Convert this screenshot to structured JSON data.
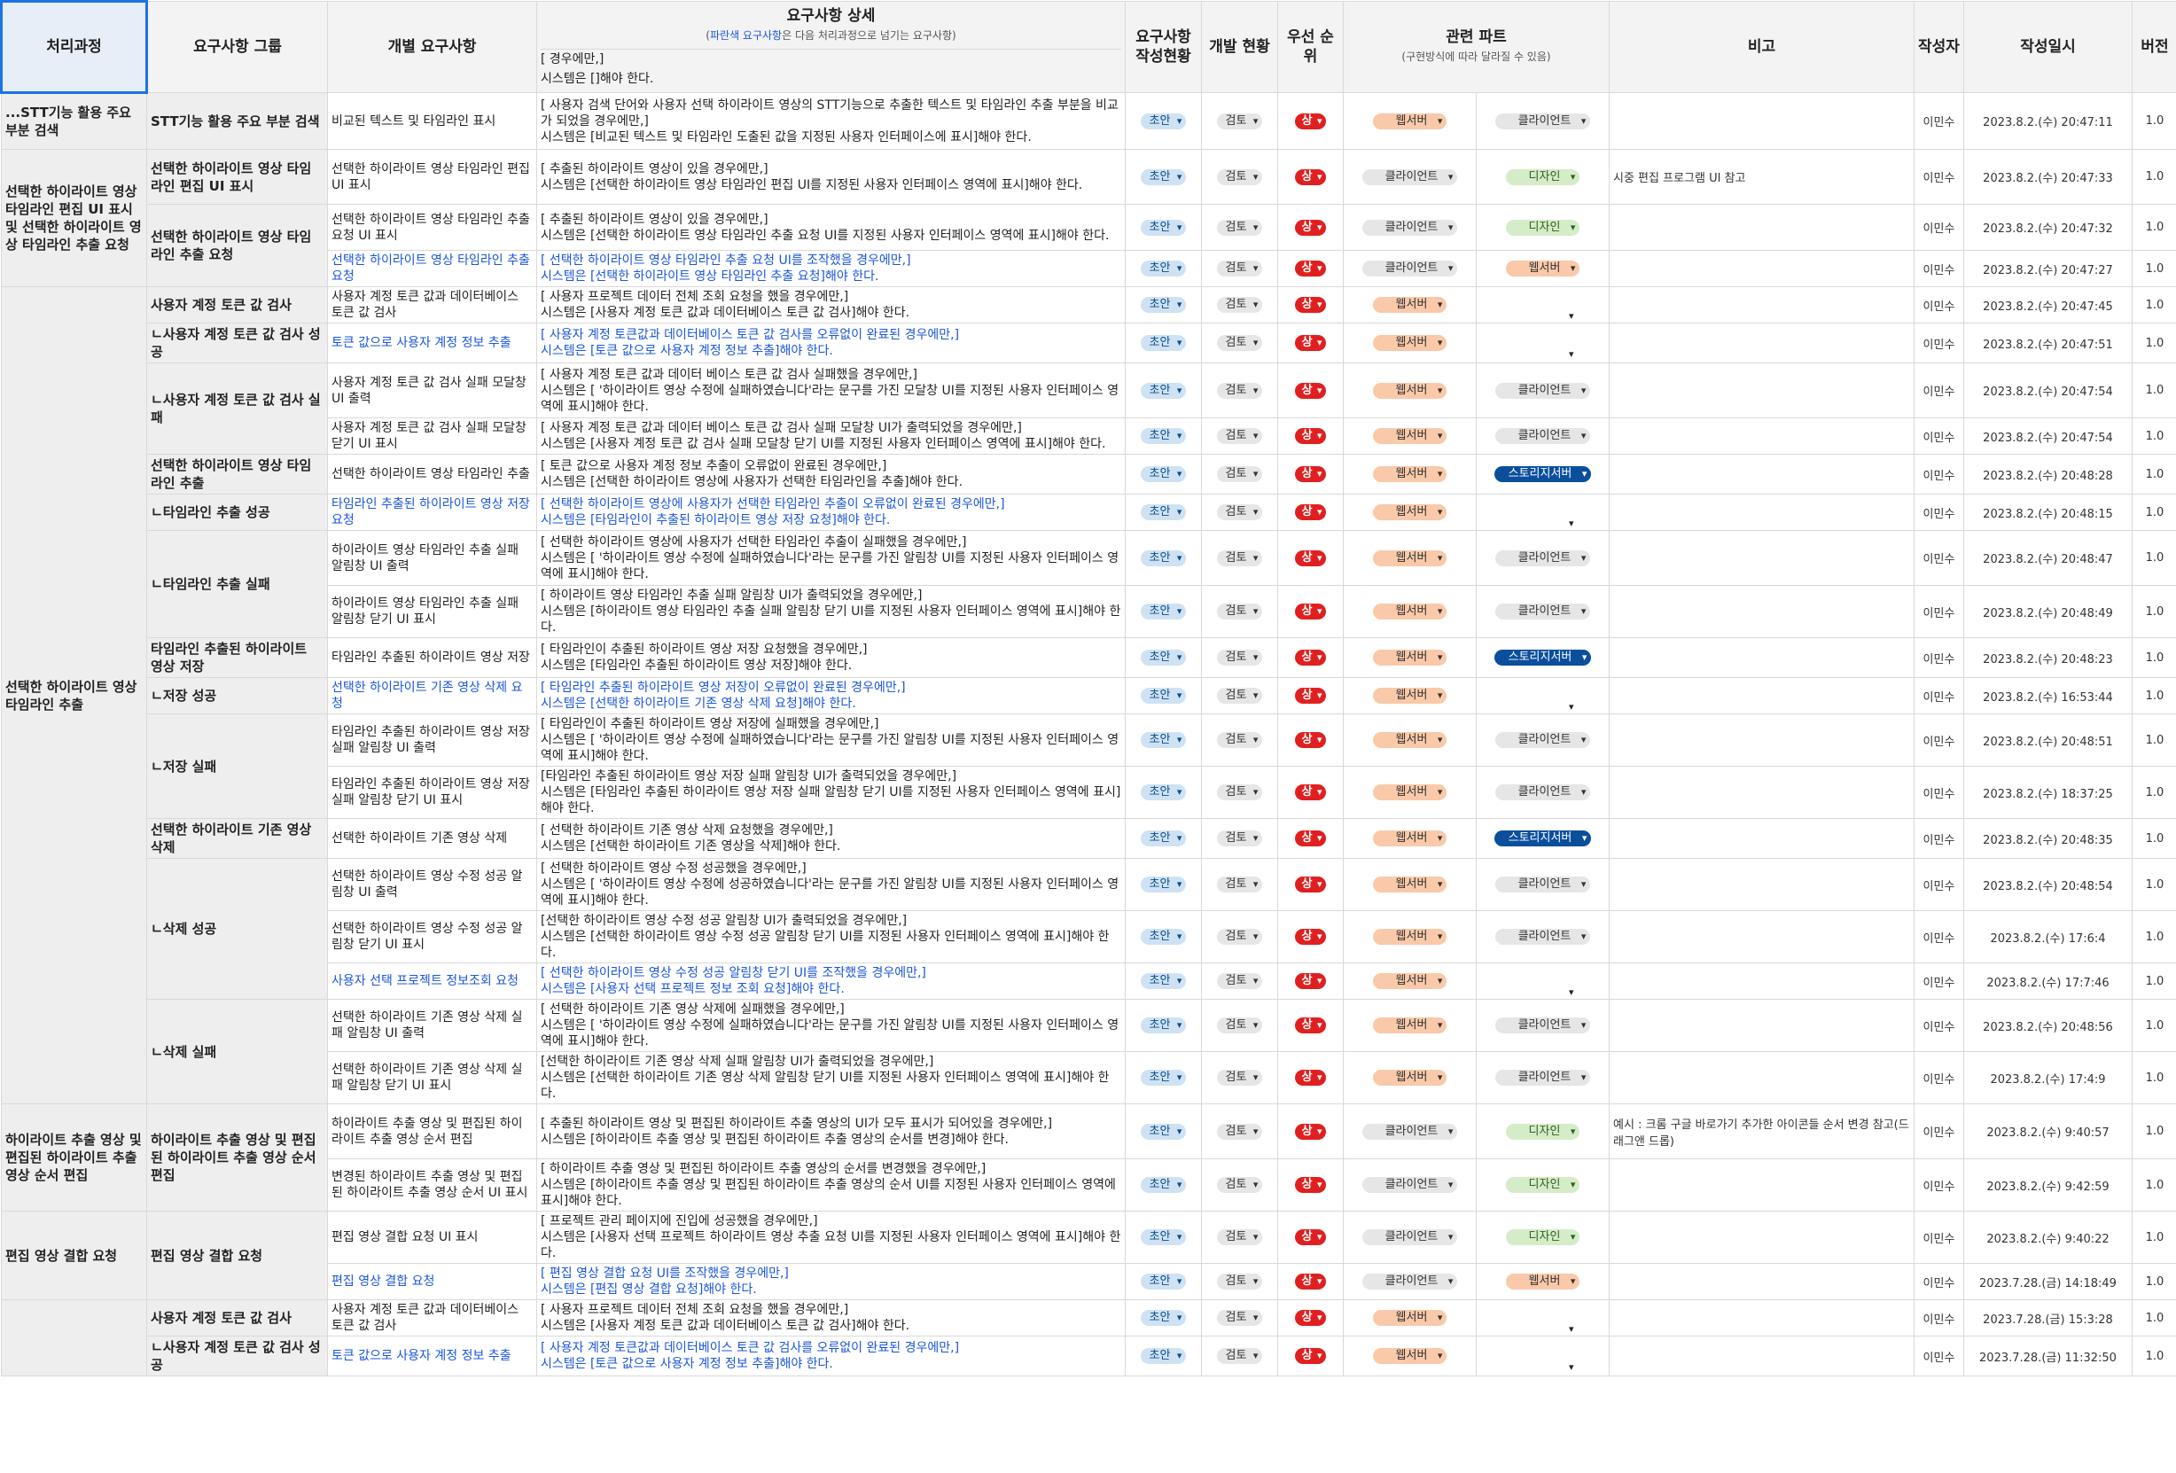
{
  "headers": {
    "process": "처리과정",
    "group": "요구사항 그룹",
    "individual": "개별 요구사항",
    "detail": "요구사항 상세",
    "detail_sub_blue": "파란색 요구사항",
    "detail_sub_rest": "은 다음 처리과정으로 넘기는 요구사항",
    "status": "요구사항 작성현황",
    "dev": "개발 현황",
    "priority": "우선 순위",
    "parts": "관련 파트",
    "parts_sub": "(구현방식에 따라 달라질 수 있음)",
    "note": "비고",
    "author": "작성자",
    "date": "작성일시",
    "version": "버전"
  },
  "labels": {
    "draft": "초안",
    "review": "검토",
    "high": "상"
  },
  "rows": [
    {
      "p": "...STT기능 활용 주요 부분 검색",
      "g": "STT기능 활용 주요 부분 검색",
      "i": "비교된 텍스트 및 타임라인 표시",
      "d": "[ 사용자 검색 단어와 사용자 선택 하이라이트 영상의 STT기능으로 추출한 텍스트 및 타임라인 추출 부분을 비교가 되었을 경우에만,]\n시스템은 [비교된 텍스트 및 타임라인 도출된 값을 지정된 사용자 인터페이스에 표시]해야 한다.",
      "blue": false,
      "p1": "웹서버",
      "p2": "클라이언트",
      "note": "",
      "date": "2023.8.2.(수) 20:47:11"
    },
    {
      "p": "선택한 하이라이트 영상 타임라인 편집 UI 표시 및 선택한 하이라이트 영상 타임라인 추출 요청",
      "g": "선택한 하이라이트 영상 타임라인 편집 UI 표시",
      "i": "선택한 하이라이트 영상 타임라인 편집 UI 표시",
      "d": "[ 추출된 하이라이트 영상이 있을 경우에만,]\n시스템은 [선택한 하이라이트 영상 타임라인 편집 UI를 지정된 사용자 인터페이스 영역에 표시]해야 한다.",
      "blue": false,
      "p1": "클라이언트",
      "p2": "디자인",
      "note": "시중 편집 프로그램 UI 참고",
      "date": "2023.8.2.(수) 20:47:33"
    },
    {
      "p": "",
      "g": "선택한 하이라이트 영상 타임라인 추출 요청",
      "i": "선택한 하이라이트 영상 타임라인 추출 요청 UI 표시",
      "d": "[ 추출된 하이라이트 영상이 있을 경우에만,]\n시스템은 [선택한 하이라이트 영상 타임라인 추출 요청 UI를 지정된 사용자 인터페이스 영역에 표시]해야 한다.",
      "blue": false,
      "p1": "클라이언트",
      "p2": "디자인",
      "note": "",
      "date": "2023.8.2.(수) 20:47:32"
    },
    {
      "p": "",
      "g": "",
      "i": "선택한 하이라이트 영상 타임라인 추출 요청",
      "d": "[ 선택한 하이라이트 영상 타임라인 추출 요청 UI를 조작했을 경우에만,]\n시스템은 [선택한 하이라이트 영상 타임라인 추출 요청]해야 한다.",
      "blue": true,
      "p1": "클라이언트",
      "p2": "웹서버",
      "note": "",
      "date": "2023.8.2.(수) 20:47:27"
    },
    {
      "p": "선택한 하이라이트 영상 타임라인 추출",
      "g": "사용자 계정 토큰 값 검사",
      "i": "사용자 계정 토큰 값과 데이터베이스 토큰 값 검사",
      "d": "[ 사용자 프로젝트 데이터 전체 조회 요청을 했을 경우에만,]\n시스템은 [사용자 계정 토큰 값과 데이터베이스 토큰 값 검사]해야 한다.",
      "blue": false,
      "p1": "웹서버",
      "p2": "",
      "note": "",
      "date": "2023.8.2.(수) 20:47:45"
    },
    {
      "p": "",
      "g": "ㄴ사용자 계정 토큰 값 검사 성공",
      "i": "토큰 값으로 사용자 계정 정보 추출",
      "d": "[ 사용자 계정 토큰값과 데이터베이스 토큰 값 검사를 오류없이 완료된 경우에만,]\n시스템은 [토큰 값으로 사용자 계정 정보 추출]해야 한다.",
      "blue": true,
      "p1": "웹서버",
      "p2": "",
      "note": "",
      "date": "2023.8.2.(수) 20:47:51"
    },
    {
      "p": "",
      "g": "ㄴ사용자 계정 토큰 값 검사 실패",
      "i": "사용자 계정 토큰 값 검사 실패 모달창 UI 출력",
      "d": "[ 사용자 계정 토큰 값과 데이터 베이스 토큰 값 검사 실패했을 경우에만,]\n시스템은 [ '하이라이트 영상 수정에 실패하였습니다'라는 문구를 가진 모달창 UI를 지정된 사용자 인터페이스 영역에 표시]해야 한다.",
      "blue": false,
      "p1": "웹서버",
      "p2": "클라이언트",
      "note": "",
      "date": "2023.8.2.(수) 20:47:54"
    },
    {
      "p": "",
      "g": "",
      "i": "사용자 계정 토큰 값 검사 실패 모달창 닫기 UI 표시",
      "d": "[ 사용자 계정 토큰 값과 데이터 베이스 토큰 값 검사 실패 모달창 UI가 출력되었을 경우에만,]\n시스템은 [사용자 계정 토큰 값 검사 실패 모달창 닫기 UI를 지정된 사용자 인터페이스 영역에 표시]해야 한다.",
      "blue": false,
      "p1": "웹서버",
      "p2": "클라이언트",
      "note": "",
      "date": "2023.8.2.(수) 20:47:54"
    },
    {
      "p": "",
      "g": "선택한 하이라이트 영상 타임라인 추출",
      "i": "선택한 하이라이트 영상 타임라인 추출",
      "d": "[ 토큰 값으로 사용자 계정 정보 추출이 오류없이 완료된 경우에만,]\n시스템은 [선택한 하이라이트 영상에 사용자가 선택한 타임라인을 추출]해야 한다.",
      "blue": false,
      "p1": "웹서버",
      "p2": "스토리지서버",
      "note": "",
      "date": "2023.8.2.(수) 20:48:28"
    },
    {
      "p": "",
      "g": "ㄴ타임라인 추출 성공",
      "i": "타임라인 추출된 하이라이트 영상 저장 요청",
      "d": "[ 선택한 하이라이트 영상에 사용자가 선택한 타임라인 추출이 오류없이 완료된 경우에만,]\n시스템은 [타임라인이 추출된 하이라이트 영상 저장 요청]해야 한다.",
      "blue": true,
      "p1": "웹서버",
      "p2": "",
      "note": "",
      "date": "2023.8.2.(수) 20:48:15"
    },
    {
      "p": "",
      "g": "ㄴ타임라인 추출 실패",
      "i": "하이라이트 영상 타임라인 추출 실패 알림창 UI 출력",
      "d": "[ 선택한 하이라이트 영상에 사용자가 선택한 타임라인 추출이 실패했을 경우에만,]\n시스템은 [ '하이라이트 영상 수정에 실패하였습니다'라는 문구를 가진 알림창 UI를 지정된 사용자 인터페이스 영역에 표시]해야 한다.",
      "blue": false,
      "p1": "웹서버",
      "p2": "클라이언트",
      "note": "",
      "date": "2023.8.2.(수) 20:48:47"
    },
    {
      "p": "",
      "g": "",
      "i": "하이라이트 영상 타임라인 추출 실패 알림창 닫기 UI 표시",
      "d": "[ 하이라이트 영상 타임라인 추출 실패 알림창 UI가 출력되었을 경우에만,]\n시스템은 [하이라이트 영상 타임라인 추출 실패 알림창 닫기 UI를 지정된 사용자 인터페이스 영역에 표시]해야 한다.",
      "blue": false,
      "p1": "웹서버",
      "p2": "클라이언트",
      "note": "",
      "date": "2023.8.2.(수) 20:48:49"
    },
    {
      "p": "",
      "g": "타임라인 추출된 하이라이트 영상 저장",
      "i": "타임라인 추출된 하이라이트 영상 저장",
      "d": "[ 타임라인이 추출된 하이라이트 영상 저장 요청했을 경우에만,]\n시스템은 [타임라인 추출된 하이라이트 영상 저장]해야 한다.",
      "blue": false,
      "p1": "웹서버",
      "p2": "스토리지서버",
      "note": "",
      "date": "2023.8.2.(수) 20:48:23"
    },
    {
      "p": "",
      "g": "ㄴ저장 성공",
      "i": "선택한 하이라이트 기존 영상 삭제 요청",
      "d": "[ 타임라인 추출된 하이라이트 영상 저장이 오류없이 완료된 경우에만,]\n시스템은 [선택한 하이라이트 기존 영상 삭제 요청]해야 한다.",
      "blue": true,
      "p1": "웹서버",
      "p2": "",
      "note": "",
      "date": "2023.8.2.(수) 16:53:44"
    },
    {
      "p": "",
      "g": "ㄴ저장 실패",
      "i": "타임라인 추출된 하이라이트 영상 저장 실패 알림창 UI 출력",
      "d": "[ 타임라인이 추출된 하이라이트 영상 저장에 실패했을 경우에만,]\n시스템은 [ '하이라이트 영상 수정에 실패하였습니다'라는 문구를 가진 알림창 UI를 지정된 사용자 인터페이스 영역에 표시]해야 한다.",
      "blue": false,
      "p1": "웹서버",
      "p2": "클라이언트",
      "note": "",
      "date": "2023.8.2.(수) 20:48:51"
    },
    {
      "p": "",
      "g": "",
      "i": "타임라인 추출된 하이라이트 영상 저장 실패 알림창 닫기 UI 표시",
      "d": "[타임라인 추출된 하이라이트 영상 저장 실패 알림창 UI가 출력되었을 경우에만,]\n시스템은 [타임라인 추출된 하이라이트 영상 저장 실패 알림창 닫기 UI를 지정된 사용자 인터페이스 영역에 표시]해야 한다.",
      "blue": false,
      "p1": "웹서버",
      "p2": "클라이언트",
      "note": "",
      "date": "2023.8.2.(수) 18:37:25"
    },
    {
      "p": "",
      "g": "선택한 하이라이트 기존 영상 삭제",
      "i": "선택한 하이라이트 기존 영상 삭제",
      "d": "[ 선택한 하이라이트 기존 영상 삭제 요청했을 경우에만,]\n시스템은 [선택한 하이라이트 기존 영상을 삭제]해야 한다.",
      "blue": false,
      "p1": "웹서버",
      "p2": "스토리지서버",
      "note": "",
      "date": "2023.8.2.(수) 20:48:35"
    },
    {
      "p": "",
      "g": "ㄴ삭제 성공",
      "i": "선택한 하이라이트 영상 수정 성공 알림창 UI 출력",
      "d": "[ 선택한 하이라이트 영상 수정 성공했을 경우에만,]\n시스템은 [ '하이라이트 영상 수정에 성공하였습니다'라는 문구를 가진 알림창 UI를 지정된 사용자 인터페이스 영역에 표시]해야 한다.",
      "blue": false,
      "p1": "웹서버",
      "p2": "클라이언트",
      "note": "",
      "date": "2023.8.2.(수) 20:48:54"
    },
    {
      "p": "",
      "g": "",
      "i": "선택한 하이라이트 영상 수정 성공 알림창 닫기 UI 표시",
      "d": "[선택한 하이라이트 영상 수정 성공 알림창 UI가 출력되었을 경우에만,]\n시스템은 [선택한 하이라이트 영상 수정 성공 알림창 닫기 UI를 지정된 사용자 인터페이스 영역에 표시]해야 한다.",
      "blue": false,
      "p1": "웹서버",
      "p2": "클라이언트",
      "note": "",
      "date": "2023.8.2.(수) 17:6:4"
    },
    {
      "p": "",
      "g": "",
      "i": "사용자 선택 프로젝트 정보조회 요청",
      "d": "[ 선택한 하이라이트 영상 수정 성공 알림창 닫기 UI를 조작했을 경우에만,]\n시스템은 [사용자 선택 프로젝트 정보 조회 요청]해야 한다.",
      "blue": true,
      "p1": "웹서버",
      "p2": "",
      "note": "",
      "date": "2023.8.2.(수) 17:7:46"
    },
    {
      "p": "",
      "g": "ㄴ삭제 실패",
      "i": "선택한 하이라이트 기존 영상 삭제 실패 알림창 UI 출력",
      "d": "[ 선택한 하이라이트 기존 영상 삭제에 실패했을 경우에만,]\n시스템은 [ '하이라이트 영상 수정에 실패하였습니다'라는 문구를 가진 알림창 UI를 지정된 사용자 인터페이스 영역에 표시]해야 한다.",
      "blue": false,
      "p1": "웹서버",
      "p2": "클라이언트",
      "note": "",
      "date": "2023.8.2.(수) 20:48:56"
    },
    {
      "p": "",
      "g": "",
      "i": "선택한 하이라이트 기존 영상 삭제 실패 알림창 닫기 UI 표시",
      "d": "[선택한 하이라이트 기존 영상 삭제 실패 알림창 UI가 출력되었을 경우에만,]\n시스템은 [선택한 하이라이트 기존 영상 삭제 알림창 닫기 UI를 지정된 사용자 인터페이스 영역에 표시]해야 한다.",
      "blue": false,
      "p1": "웹서버",
      "p2": "클라이언트",
      "note": "",
      "date": "2023.8.2.(수) 17:4:9"
    },
    {
      "p": "하이라이트 추출 영상 및 편집된 하이라이트 추출 영상 순서 편집",
      "g": "하이라이트 추출 영상 및 편집된 하이라이트 추출 영상 순서 편집",
      "i": "하이라이트 추출 영상 및 편집된 하이라이트 추출 영상 순서 편집",
      "d": "[ 추출된 하이라이트 영상 및 편집된 하이라이트 추출 영상의 UI가 모두 표시가 되어있을 경우에만,]\n시스템은 [하이라이트 추출 영상 및 편집된 하이라이트 추출 영상의 순서를 변경]해야 한다.",
      "blue": false,
      "p1": "클라이언트",
      "p2": "디자인",
      "note": "예시 : 크롬 구글 바로가기 추가한 아이콘들 순서 변경 참고(드래그앤 드롭)",
      "date": "2023.8.2.(수) 9:40:57"
    },
    {
      "p": "",
      "g": "",
      "i": "변경된 하이라이트 추출 영상 및 편집된 하이라이트 추출 영상 순서 UI 표시",
      "d": "[ 하이라이트 추출 영상 및 편집된 하이라이트 추출 영상의 순서를 변경했을 경우에만,]\n시스템은 [하이라이트 추출 영상 및 편집된 하이라이트 추출 영상의 순서 UI를 지정된 사용자 인터페이스 영역에 표시]해야 한다.",
      "blue": false,
      "p1": "클라이언트",
      "p2": "디자인",
      "note": "",
      "date": "2023.8.2.(수) 9:42:59"
    },
    {
      "p": "편집 영상 결합 요청",
      "g": "편집 영상 결합 요청",
      "i": "편집 영상 결합 요청 UI 표시",
      "d": "[ 프로젝트 관리 페이지에 진입에 성공했을 경우에만,]\n시스템은 [사용자 선택 프로젝트 하이라이트 영상 추출 요청 UI를 지정된 사용자 인터페이스 영역에 표시]해야 한다.",
      "blue": false,
      "p1": "클라이언트",
      "p2": "디자인",
      "note": "",
      "date": "2023.8.2.(수) 9:40:22"
    },
    {
      "p": "",
      "g": "",
      "i": "편집 영상 결합 요청",
      "d": "[ 편집 영상 결합 요청 UI를 조작했을 경우에만,]\n시스템은 [편집 영상 결합 요청]해야 한다.",
      "blue": true,
      "p1": "클라이언트",
      "p2": "웹서버",
      "note": "",
      "date": "2023.7.28.(금) 14:18:49"
    },
    {
      "p": "",
      "g": "사용자 계정 토큰 값 검사",
      "i": "사용자 계정 토큰 값과 데이터베이스 토큰 값 검사",
      "d": "[ 사용자 프로젝트 데이터 전체 조회 요청을 했을 경우에만,]\n시스템은 [사용자 계정 토큰 값과 데이터베이스 토큰 값 검사]해야 한다.",
      "blue": false,
      "p1": "웹서버",
      "p2": "",
      "note": "",
      "date": "2023.7.28.(금) 15:3:28"
    },
    {
      "p": "",
      "g": "ㄴ사용자 계정 토큰 값 검사 성공",
      "i": "토큰 값으로 사용자 계정 정보 추출",
      "d": "[ 사용자 계정 토큰값과 데이터베이스 토큰 값 검사를 오류없이 완료된 경우에만,]\n시스템은 [토큰 값으로 사용자 계정 정보 추출]해야 한다.",
      "blue": true,
      "p1": "웹서버",
      "p2": "",
      "note": "",
      "date": "2023.7.28.(금) 11:32:50"
    }
  ],
  "header_row_partial": {
    "d": "[ 경우에만,]\n시스템은 []해야 한다."
  },
  "author": "이민수",
  "version": "1.0"
}
